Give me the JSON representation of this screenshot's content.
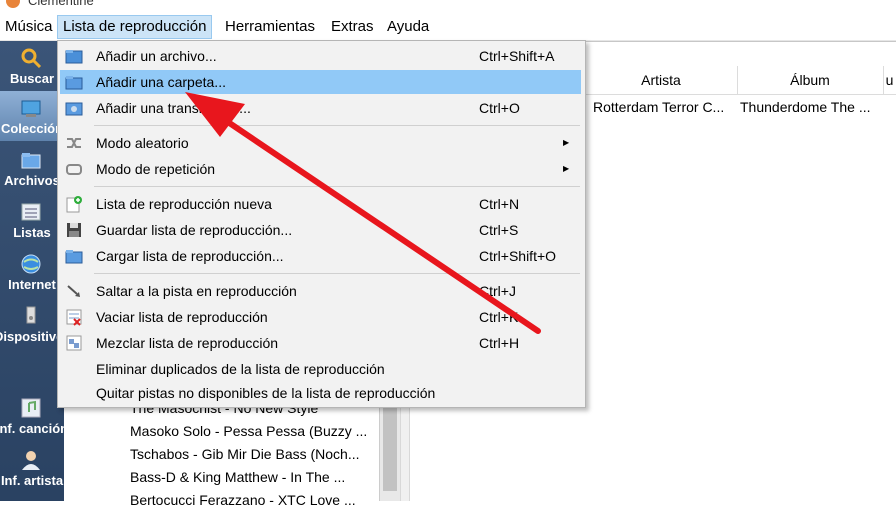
{
  "window": {
    "title": "Clementine"
  },
  "menubar": {
    "items": [
      {
        "label": "Música",
        "underline": "M"
      },
      {
        "label": "Lista de reproducción",
        "underline": "L"
      },
      {
        "label": "Herramientas",
        "underline": "H"
      },
      {
        "label": "Extras",
        "underline": "E"
      },
      {
        "label": "Ayuda",
        "underline": "A"
      }
    ],
    "open_item": "Lista de reproducción"
  },
  "sidebar": {
    "items": [
      {
        "label": "Buscar",
        "icon": "search-icon"
      },
      {
        "label": "Colección",
        "icon": "library-icon",
        "active": true
      },
      {
        "label": "Archivos",
        "icon": "files-icon"
      },
      {
        "label": "Listas",
        "icon": "playlists-icon"
      },
      {
        "label": "Internet",
        "icon": "globe-icon"
      },
      {
        "label": "Dispositivos",
        "icon": "device-icon"
      },
      {
        "label": "Inf. canción",
        "icon": "song-info-icon"
      },
      {
        "label": "Inf. artista",
        "icon": "artist-info-icon"
      }
    ]
  },
  "library": {
    "items": [
      "The Masochist - No New Style",
      "Masoko Solo - Pessa Pessa (Buzzy ...",
      "Tschabos - Gib Mir Die Bass (Noch...",
      "Bass-D & King Matthew - In The ...",
      "Bertocucci Ferazzano - XTC Love ..."
    ]
  },
  "playlist": {
    "columns": [
      "Artista",
      "Álbum",
      "u"
    ],
    "rows": [
      {
        "artist": "Rotterdam Terror C...",
        "album": "Thunderdome The ..."
      }
    ]
  },
  "dropdown": {
    "items": [
      {
        "label": "Añadir un archivo...",
        "shortcut": "Ctrl+Shift+A",
        "icon": "add-file-icon"
      },
      {
        "label": "Añadir una carpeta...",
        "shortcut": "",
        "icon": "add-folder-icon",
        "highlighted": true
      },
      {
        "label": "Añadir una transmisión...",
        "shortcut": "Ctrl+O",
        "icon": "add-stream-icon"
      },
      {
        "label": "Modo aleatorio",
        "shortcut": "",
        "icon": "shuffle-icon",
        "submenu": true
      },
      {
        "label": "Modo de repetición",
        "shortcut": "",
        "icon": "repeat-icon",
        "submenu": true
      },
      {
        "label": "Lista de reproducción nueva",
        "shortcut": "Ctrl+N",
        "icon": "new-playlist-icon"
      },
      {
        "label": "Guardar lista de reproducción...",
        "shortcut": "Ctrl+S",
        "icon": "save-icon"
      },
      {
        "label": "Cargar lista de reproducción...",
        "shortcut": "Ctrl+Shift+O",
        "icon": "load-playlist-icon"
      },
      {
        "label": "Saltar a la pista en reproducción",
        "shortcut": "Ctrl+J",
        "icon": "jump-icon"
      },
      {
        "label": "Vaciar lista de reproducción",
        "shortcut": "Ctrl+K",
        "icon": "clear-playlist-icon"
      },
      {
        "label": "Mezclar lista de reproducción",
        "shortcut": "Ctrl+H",
        "icon": "shuffle-playlist-icon"
      },
      {
        "label": "Eliminar duplicados de la lista de reproducción",
        "shortcut": "",
        "icon": ""
      },
      {
        "label": "Quitar pistas no disponibles de la lista de reproducción",
        "shortcut": "",
        "icon": ""
      }
    ]
  },
  "colors": {
    "highlight": "#91c9f7",
    "menu_open": "#cce4f7",
    "sidebar": "#2f4a6d",
    "arrow": "#e8161d"
  }
}
